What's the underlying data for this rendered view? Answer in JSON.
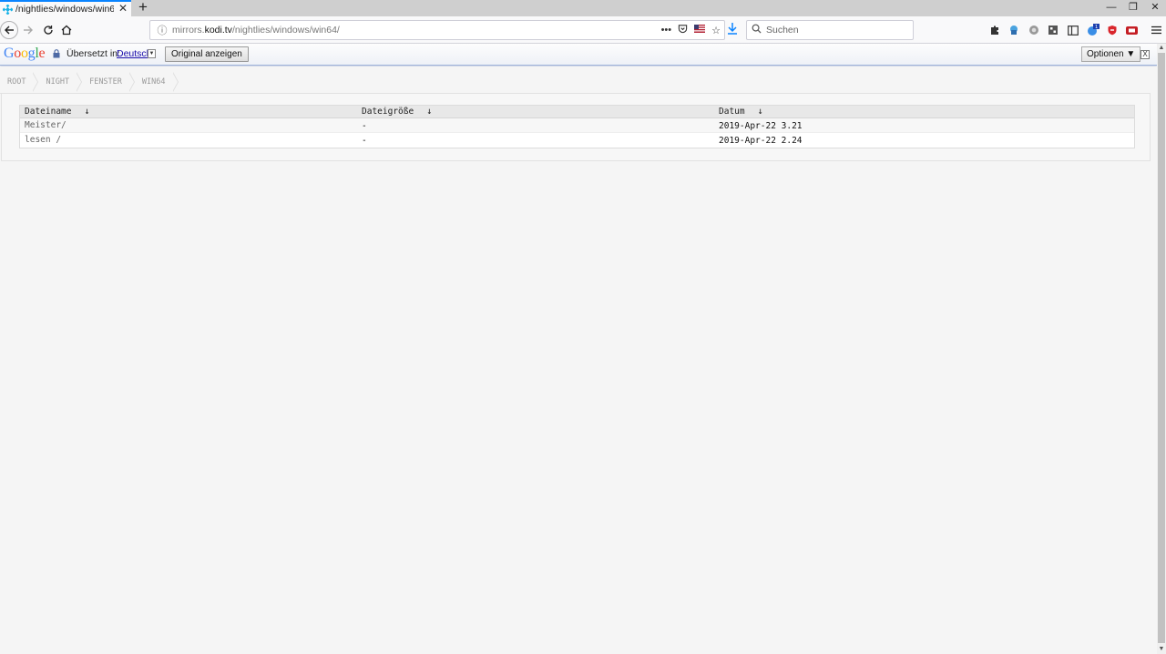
{
  "browser": {
    "tab_title": "/nightlies/windows/win64/",
    "tab_close": "✕",
    "new_tab": "+",
    "url_prefix": "mirrors.",
    "url_host": "kodi.tv",
    "url_path": "/nightlies/windows/win64/",
    "search_placeholder": "Suchen",
    "window_controls": [
      "—",
      "❐",
      "✕"
    ]
  },
  "translate_bar": {
    "logo_letters": [
      "G",
      "o",
      "o",
      "g",
      "l",
      "e"
    ],
    "logo_colors": [
      "#4285f4",
      "#ea4335",
      "#fbbc05",
      "#4285f4",
      "#34a853",
      "#ea4335"
    ],
    "label": "Übersetzt in:",
    "language": "Deutsch",
    "original_button": "Original anzeigen",
    "options_button": "Optionen ▼",
    "close": "X"
  },
  "breadcrumb": [
    "ROOT",
    "NIGHT",
    "FENSTER",
    "WIN64"
  ],
  "table": {
    "headers": [
      "Dateiname",
      "Dateigröße",
      "Datum"
    ],
    "sort_icon": "↓",
    "rows": [
      {
        "name": "Meister/",
        "size": "-",
        "date": "2019-Apr-22 3.21"
      },
      {
        "name": "lesen /",
        "size": "-",
        "date": "2019-Apr-22 2.24"
      }
    ]
  }
}
